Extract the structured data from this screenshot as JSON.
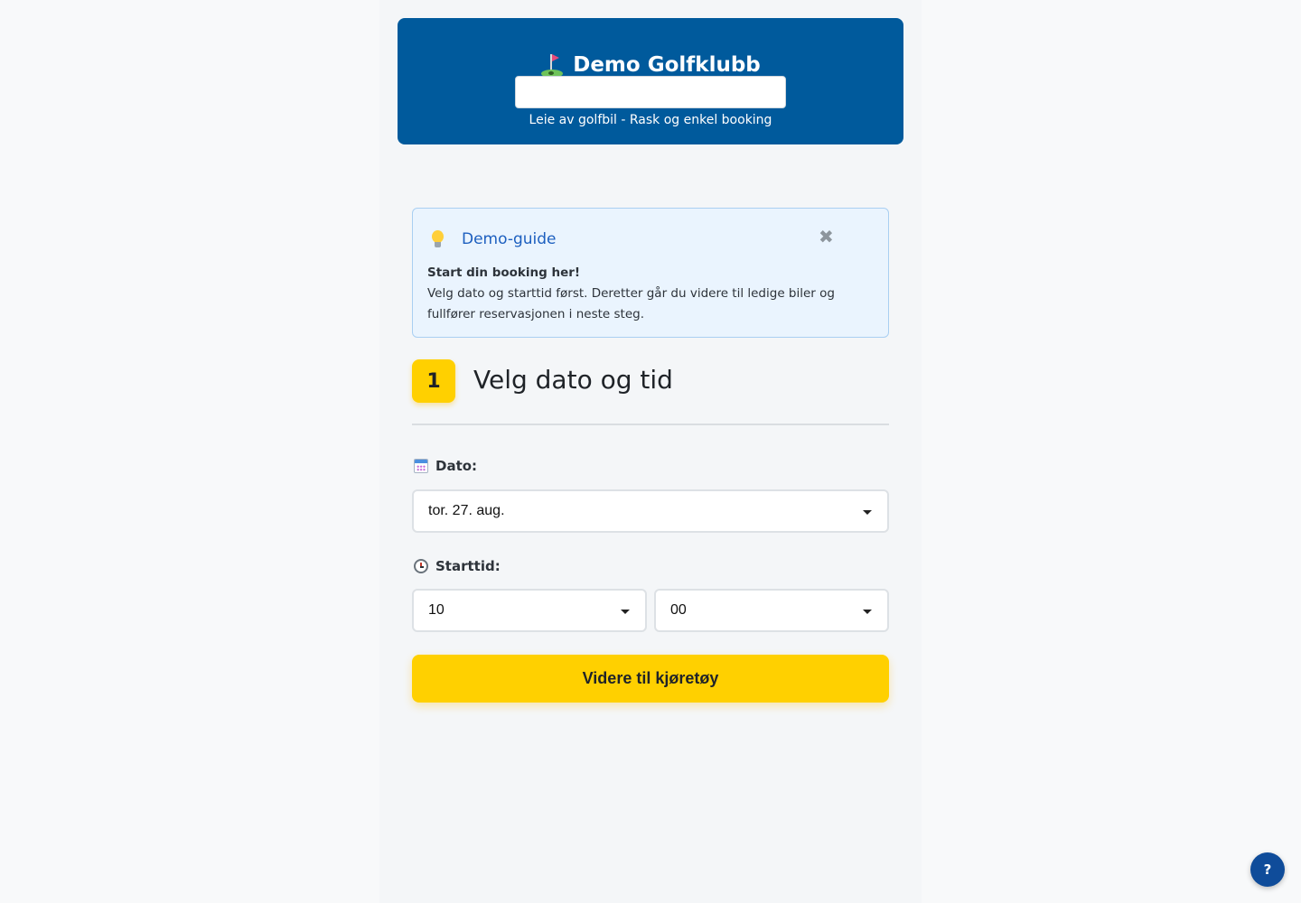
{
  "header": {
    "title": "Demo Golfklubb",
    "title_icon": "golf-flag-icon",
    "input_value": "",
    "subtitle": "Leie av golfbil - Rask og enkel booking",
    "background_color": "#005a9c"
  },
  "guide": {
    "icon": "lightbulb-icon",
    "title": "Demo-guide",
    "close_label": "✖",
    "heading": "Start din booking her!",
    "text": "Velg dato og starttid først. Deretter går du videre til ledige biler og fullfører reservasjonen i neste steg."
  },
  "step": {
    "number": "1",
    "title": "Velg dato og tid"
  },
  "date_field": {
    "icon": "calendar-icon",
    "label": "Dato:",
    "selected": "tor. 27. aug."
  },
  "time_field": {
    "icon": "stopwatch-icon",
    "label": "Starttid:",
    "hour_selected": "10",
    "minute_selected": "00"
  },
  "submit_button": {
    "label": "Videre til kjøretøy",
    "color": "#ffd000"
  },
  "help_button": {
    "label": "?",
    "color": "#0f4c9a"
  }
}
